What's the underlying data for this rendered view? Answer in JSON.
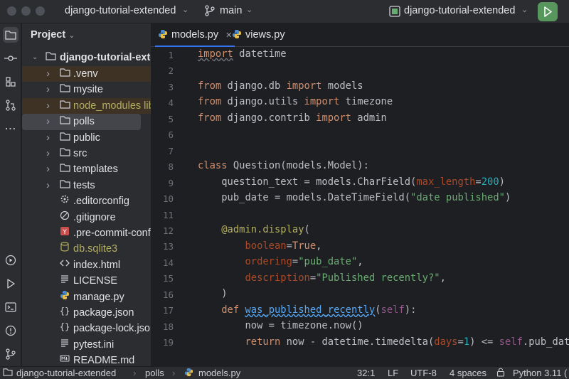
{
  "titlebar": {
    "project_name": "django-tutorial-extended",
    "branch": "main",
    "run_config": "django-tutorial-extended"
  },
  "colors": {
    "accent": "#3574f0",
    "run_green": "#57965c",
    "bg": "#1e1f22",
    "panel": "#2b2d30"
  },
  "project_panel": {
    "title": "Project",
    "root": "django-tutorial-extended",
    "items": [
      {
        "label": ".venv",
        "type": "folder",
        "color": "#dfe1e5"
      },
      {
        "label": "mysite",
        "type": "folder",
        "color": "#dfe1e5"
      },
      {
        "label": "node_modules  libr",
        "type": "folder",
        "color": "#b3ae60"
      },
      {
        "label": "polls",
        "type": "folder",
        "color": "#dfe1e5"
      },
      {
        "label": "public",
        "type": "folder",
        "color": "#dfe1e5"
      },
      {
        "label": "src",
        "type": "folder",
        "color": "#dfe1e5"
      },
      {
        "label": "templates",
        "type": "folder",
        "color": "#dfe1e5"
      },
      {
        "label": "tests",
        "type": "folder",
        "color": "#dfe1e5"
      },
      {
        "label": ".editorconfig",
        "type": "gear",
        "color": "#dfe1e5"
      },
      {
        "label": ".gitignore",
        "type": "ignore",
        "color": "#dfe1e5"
      },
      {
        "label": ".pre-commit-config",
        "type": "yaml",
        "color": "#dfe1e5"
      },
      {
        "label": "db.sqlite3",
        "type": "db",
        "color": "#b3ae60"
      },
      {
        "label": "index.html",
        "type": "html",
        "color": "#dfe1e5"
      },
      {
        "label": "LICENSE",
        "type": "text",
        "color": "#dfe1e5"
      },
      {
        "label": "manage.py",
        "type": "python",
        "color": "#dfe1e5"
      },
      {
        "label": "package.json",
        "type": "json",
        "color": "#dfe1e5"
      },
      {
        "label": "package-lock.json",
        "type": "json",
        "color": "#dfe1e5"
      },
      {
        "label": "pytest.ini",
        "type": "text",
        "color": "#dfe1e5"
      },
      {
        "label": "README.md",
        "type": "markdown",
        "color": "#dfe1e5"
      }
    ]
  },
  "tabs": [
    {
      "label": "models.py",
      "active": true
    },
    {
      "label": "views.py",
      "active": false
    }
  ],
  "code": {
    "line_numbers": [
      "1",
      "2",
      "3",
      "4",
      "5",
      "6",
      "7",
      "8",
      "9",
      "10",
      "11",
      "12",
      "13",
      "14",
      "15",
      "16",
      "17",
      "18",
      "19"
    ]
  },
  "statusbar": {
    "breadcrumb_root": "django-tutorial-extended",
    "breadcrumb_folder": "polls",
    "breadcrumb_file": "models.py",
    "position": "32:1",
    "line_sep": "LF",
    "encoding": "UTF-8",
    "indent": "4 spaces",
    "interpreter": "Python 3.11 ("
  }
}
